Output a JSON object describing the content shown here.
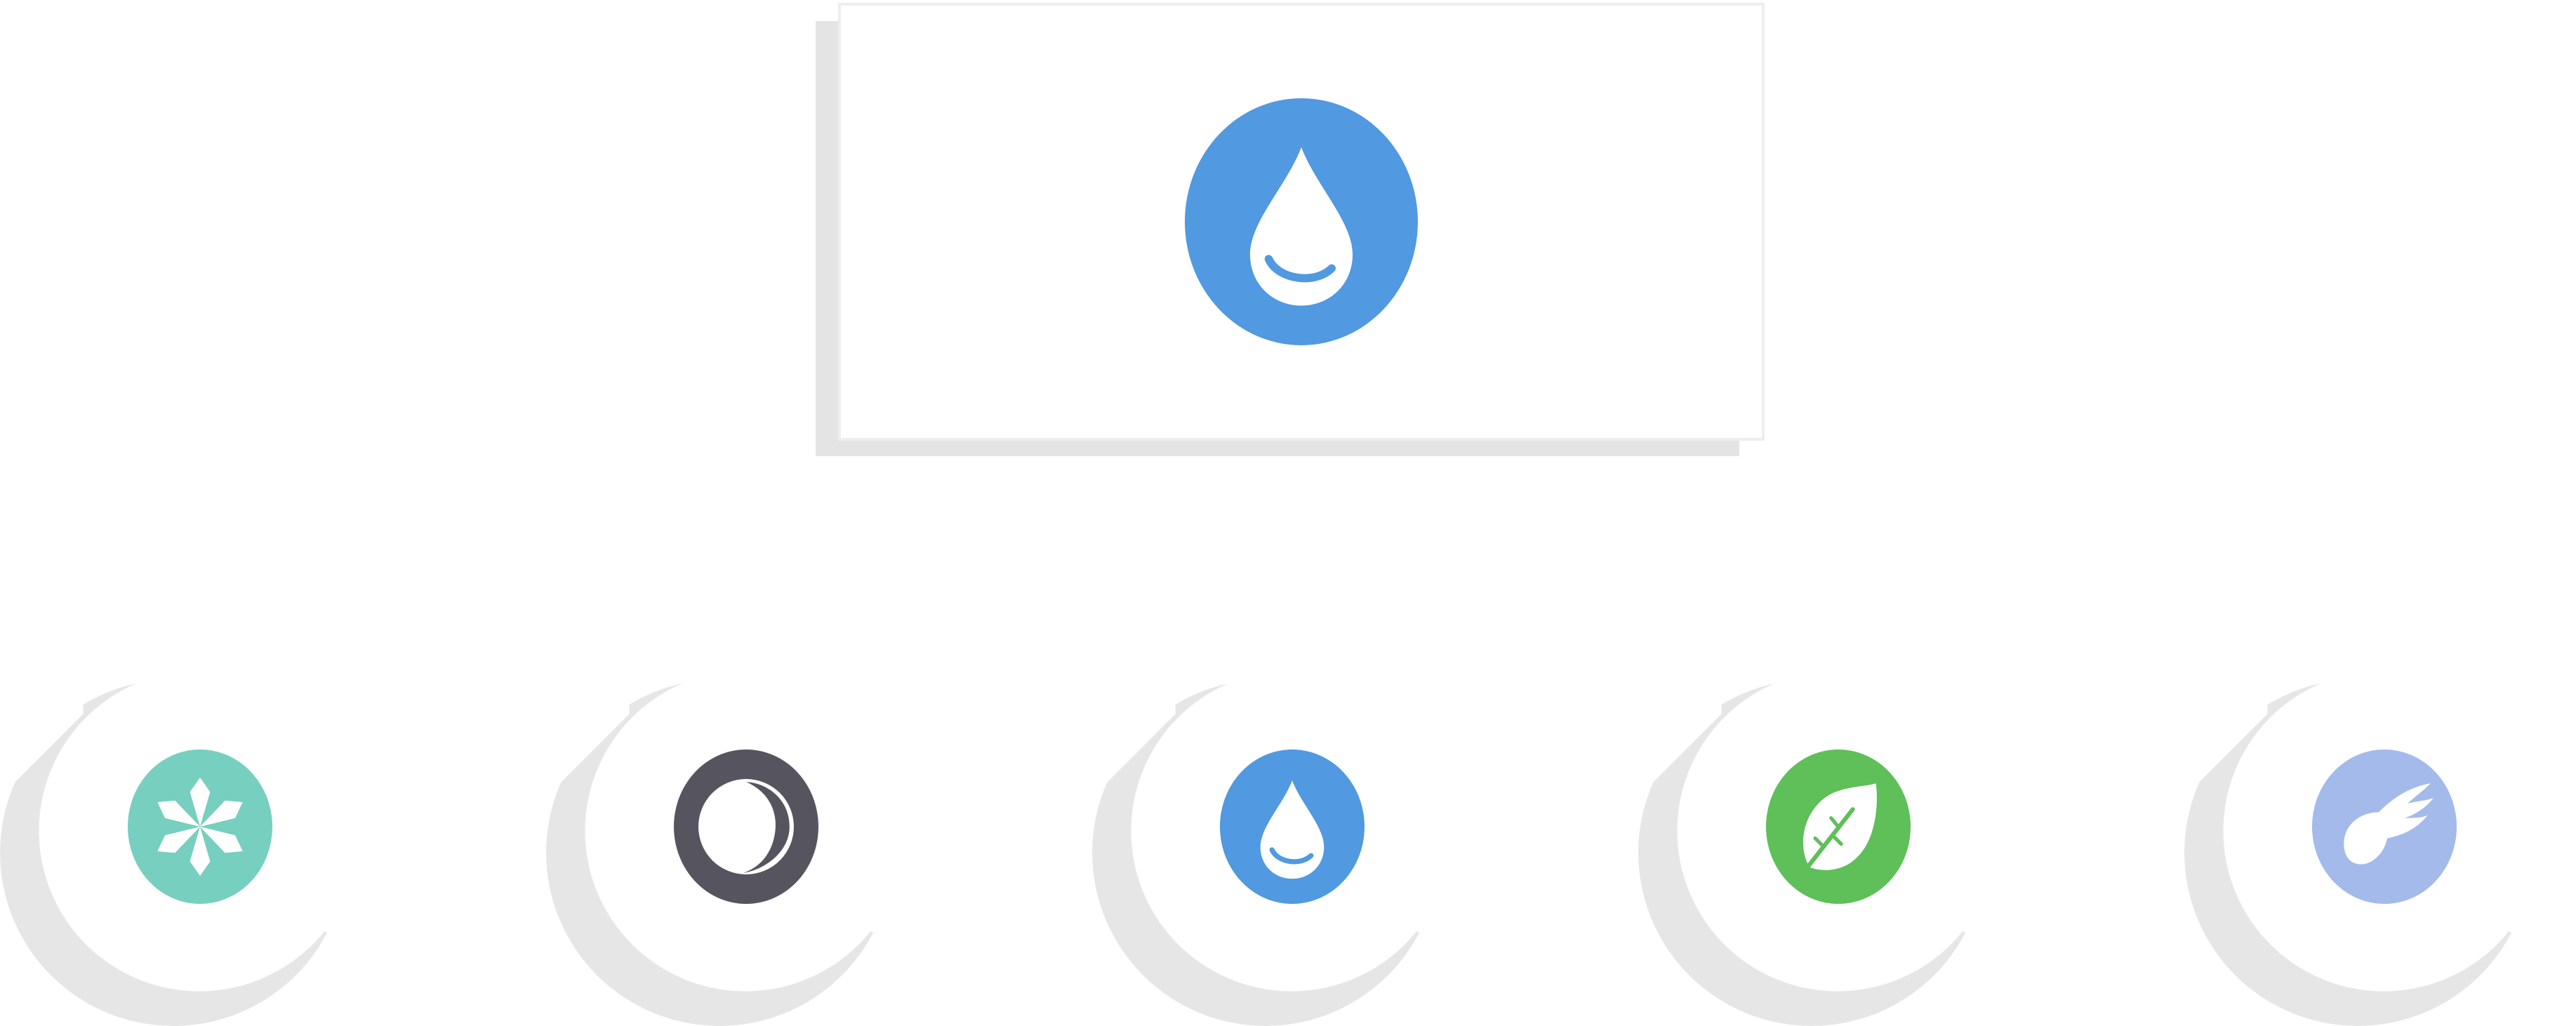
{
  "preview": {
    "icon": "water-drop-icon",
    "color": "#5199e0"
  },
  "options": [
    {
      "id": "snow",
      "icon": "snowflake-icon",
      "color": "#76cfbf"
    },
    {
      "id": "moon",
      "icon": "crescent-moon-icon",
      "color": "#55545f"
    },
    {
      "id": "water",
      "icon": "water-drop-icon",
      "color": "#5199e0"
    },
    {
      "id": "leaf",
      "icon": "leaf-icon",
      "color": "#5fbf59"
    },
    {
      "id": "wing",
      "icon": "wing-icon",
      "color": "#a3baeb"
    }
  ]
}
